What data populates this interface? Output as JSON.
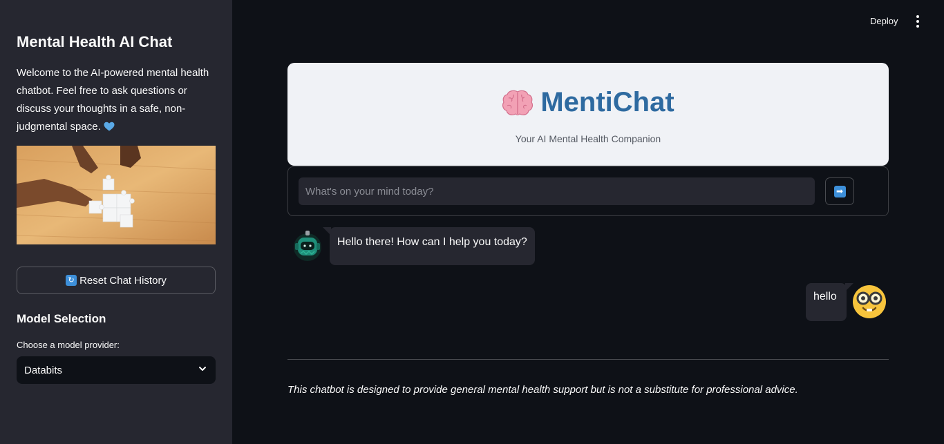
{
  "sidebar": {
    "title": "Mental Health AI Chat",
    "welcome_text": "Welcome to the AI-powered mental health chatbot. Feel free to ask questions or discuss your thoughts in a safe, non-judgmental space.",
    "welcome_emoji": "heart-icon",
    "image": "puzzle-hands-image",
    "reset_icon": "refresh-icon",
    "reset_label": "Reset Chat History",
    "model_section_title": "Model Selection",
    "provider_label": "Choose a model provider:",
    "provider_selected": "Databits"
  },
  "header": {
    "deploy_label": "Deploy",
    "menu_icon": "kebab-menu-icon"
  },
  "hero": {
    "icon": "brain-icon",
    "title": "MentiChat",
    "subtitle": "Your AI Mental Health Companion"
  },
  "chat_form": {
    "placeholder": "What's on your mind today?",
    "value": "",
    "send_icon": "arrow-right-icon"
  },
  "messages": [
    {
      "role": "assistant",
      "avatar": "robot-avatar",
      "text": "Hello there! How can I help you today?"
    },
    {
      "role": "user",
      "avatar": "nerd-face-avatar",
      "text": "hello"
    }
  ],
  "footer": {
    "disclaimer": "This chatbot is designed to provide general mental health support but is not a substitute for professional advice."
  },
  "colors": {
    "app_bg": "#0e1117",
    "sidebar_bg": "#262730",
    "hero_bg": "#f0f2f6",
    "hero_title": "#2e6aa0",
    "accent_blue": "#3d8fd9"
  }
}
